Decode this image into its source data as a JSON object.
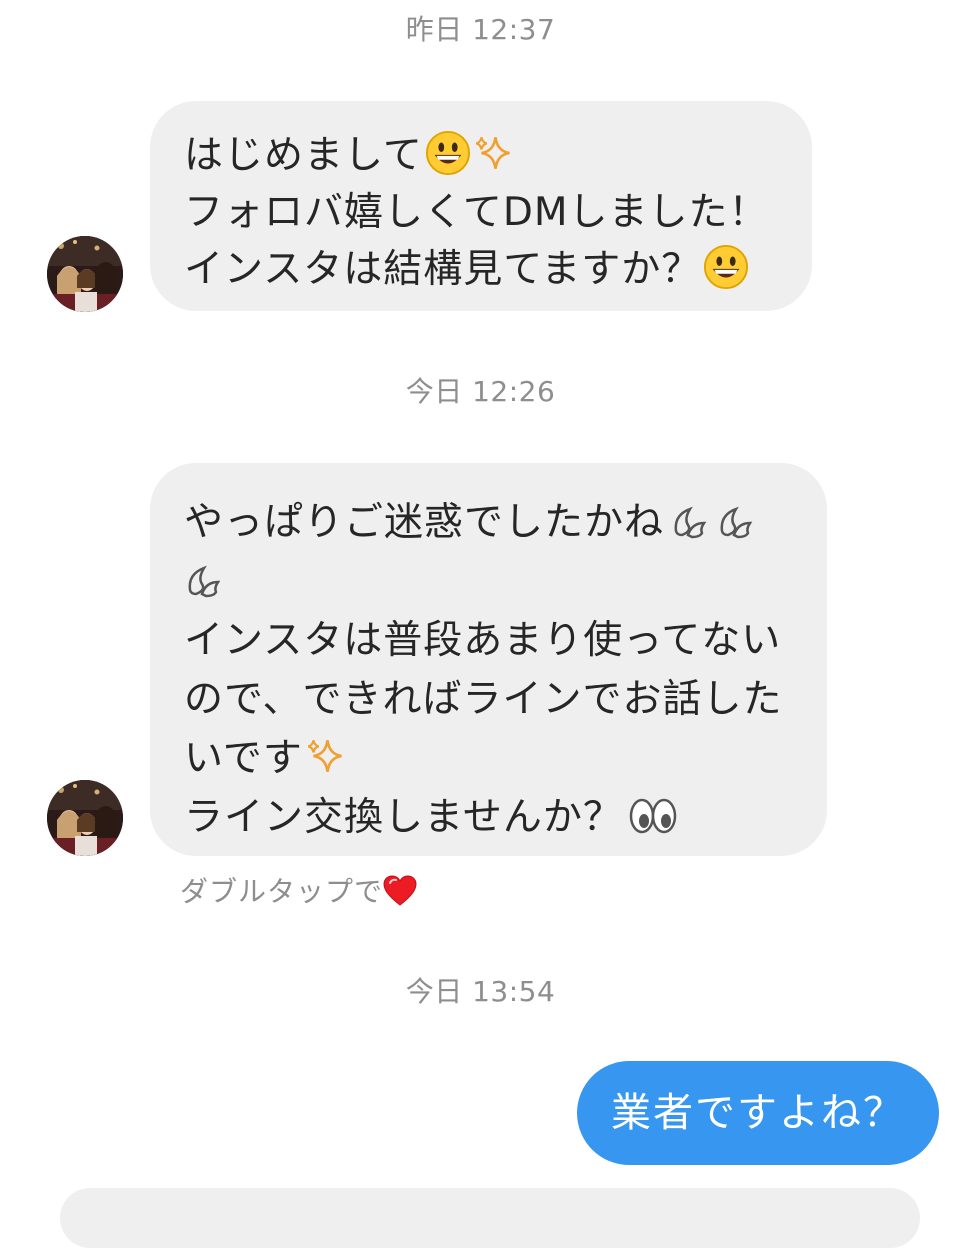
{
  "timestamps": [
    "昨日 12:37",
    "今日 12:26",
    "今日 13:54"
  ],
  "messages": [
    {
      "sender": "other",
      "lines": [
        {
          "text": "はじめまして",
          "icons": [
            "grinning-face-icon",
            "sparkles-icon"
          ]
        },
        {
          "text": "フォロバ嬉しくてDMしました！",
          "icons": []
        },
        {
          "text": "インスタは結構見てますか？",
          "icons": [
            "grinning-face-icon"
          ]
        }
      ]
    },
    {
      "sender": "other",
      "lines": [
        {
          "text": "やっぱりご迷惑でしたかね",
          "icons": [
            "sweat-drops-icon",
            "sweat-drops-icon"
          ]
        },
        {
          "text": "",
          "icons": [
            "sweat-drops-icon"
          ]
        },
        {
          "text": "インスタは普段あまり使ってない",
          "icons": []
        },
        {
          "text": "ので、できればラインでお話した",
          "icons": []
        },
        {
          "text": "いです",
          "icons": [
            "sparkles-icon"
          ]
        },
        {
          "text": "ライン交換しませんか？",
          "icons": [
            "eyes-icon"
          ]
        }
      ]
    },
    {
      "sender": "me",
      "text": "業者ですよね？"
    }
  ],
  "double_tap_hint": "ダブルタップで",
  "colors": {
    "incoming_bubble": "#efefef",
    "outgoing_bubble": "#3797f0",
    "timestamp": "#8e8e8e",
    "heart": "#ed1c24"
  }
}
